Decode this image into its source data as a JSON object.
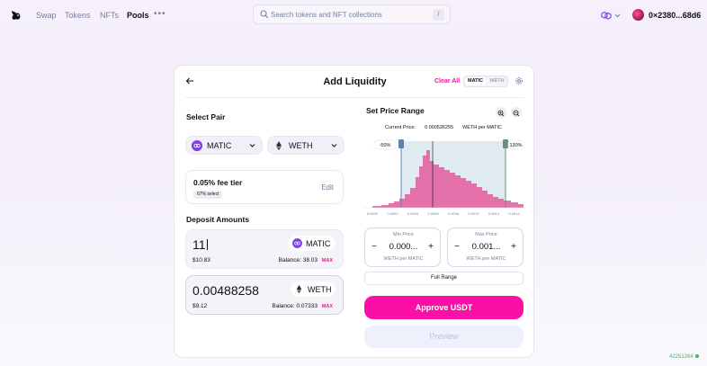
{
  "nav": {
    "swap": "Swap",
    "tokens": "Tokens",
    "nfts": "NFTs",
    "pools": "Pools",
    "more": "•••"
  },
  "search": {
    "placeholder": "Search tokens and NFT collections",
    "shortcut": "/"
  },
  "account": {
    "address": "0×2380...68d6"
  },
  "card": {
    "title": "Add Liquidity",
    "clear_all": "Clear All",
    "toggle": [
      "MATIC",
      "WETH"
    ]
  },
  "select_pair": {
    "heading": "Select Pair",
    "token_a": "MATIC",
    "token_b": "WETH"
  },
  "fee": {
    "tier": "0.05% fee tier",
    "select_badge": "67% select",
    "edit": "Edit"
  },
  "deposit": {
    "heading": "Deposit Amounts",
    "a": {
      "amount": "11",
      "token": "MATIC",
      "usd": "$10.83",
      "balance": "Balance: 38.03",
      "max": "MAX"
    },
    "b": {
      "amount": "0.00488258",
      "token": "WETH",
      "usd": "$9.12",
      "balance": "Balance: 0.07333",
      "max": "MAX"
    }
  },
  "price_range": {
    "heading": "Set Price Range",
    "current_label": "Current Price:",
    "current_value": "0.000526255",
    "current_unit": "WETH per MATIC",
    "left_tag": "-50%",
    "right_tag": "130%",
    "ticks": [
      "0.0000",
      "0.0002",
      "0.0004",
      "0.0006",
      "0.0008",
      "0.0010",
      "0.0012",
      "0.0014"
    ]
  },
  "min_price": {
    "label": "Min Price",
    "value": "0.000...",
    "unit": "WETH per MATIC"
  },
  "max_price": {
    "label": "Max Price",
    "value": "0.001...",
    "unit": "WETH per MATIC"
  },
  "full_range": "Full Range",
  "approve": "Approve USDT",
  "preview": "Preview",
  "block_number": "42251264",
  "colors": {
    "accent": "#fc0fa4",
    "range": "#a5c3d6",
    "matic": "#7b3fe4",
    "status": "#40b66b"
  }
}
